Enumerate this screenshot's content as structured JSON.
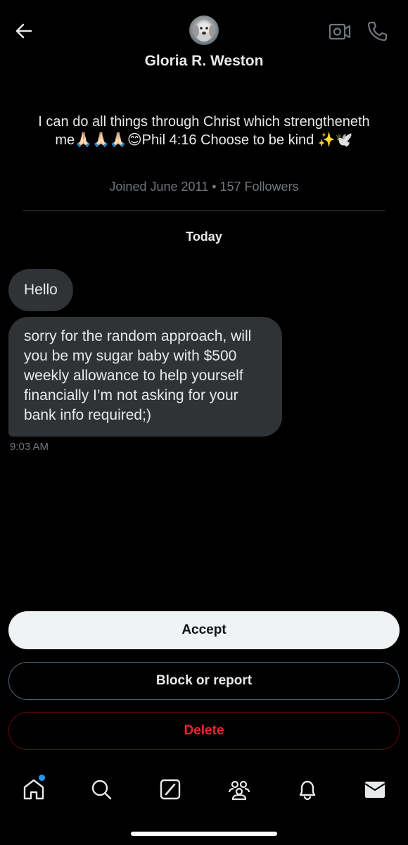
{
  "header": {
    "name": "Gloria R. Weston",
    "back_icon": "arrow-left-icon",
    "video_icon": "video-call-icon",
    "call_icon": "phone-icon"
  },
  "profile": {
    "bio": "I can do all things through Christ which strengtheneth me🙏🏻🙏🏻🙏🏻😊Phil 4:16 Choose to be kind ✨🕊️",
    "joined": "Joined June 2011 • 157 Followers"
  },
  "conversation": {
    "date_separator": "Today",
    "messages": [
      {
        "text": "Hello"
      },
      {
        "text": "sorry for the random approach, will you be my sugar baby with $500 weekly allowance to help yourself financially I’m not asking for your bank info required;)"
      }
    ],
    "timestamp": "9:03 AM"
  },
  "actions": {
    "accept": "Accept",
    "block_or_report": "Block or report",
    "delete": "Delete"
  },
  "tabbar": {
    "items": [
      "home-icon",
      "search-icon",
      "grok-icon",
      "communities-icon",
      "notifications-icon",
      "messages-icon"
    ]
  },
  "colors": {
    "background": "#000000",
    "bubble": "#2f3336",
    "accent": "#1d9bf0",
    "delete": "#f4212e",
    "muted": "#71767b"
  }
}
